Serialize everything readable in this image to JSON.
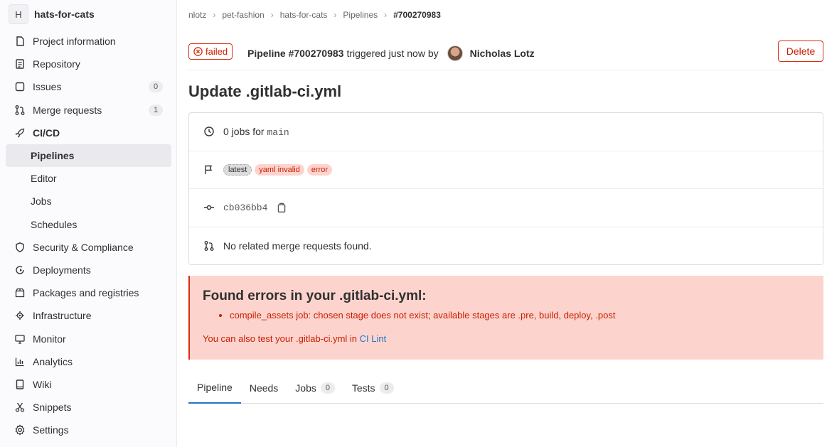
{
  "project": {
    "avatar_letter": "H",
    "name": "hats-for-cats"
  },
  "sidebar": {
    "items": [
      {
        "label": "Project information",
        "icon": "info-icon"
      },
      {
        "label": "Repository",
        "icon": "document-icon"
      },
      {
        "label": "Issues",
        "icon": "issues-icon",
        "count": "0"
      },
      {
        "label": "Merge requests",
        "icon": "merge-request-icon",
        "count": "1"
      },
      {
        "label": "CI/CD",
        "icon": "rocket-icon"
      },
      {
        "label": "Pipelines"
      },
      {
        "label": "Editor"
      },
      {
        "label": "Jobs"
      },
      {
        "label": "Schedules"
      },
      {
        "label": "Security & Compliance",
        "icon": "shield-icon"
      },
      {
        "label": "Deployments",
        "icon": "deployments-icon"
      },
      {
        "label": "Packages and registries",
        "icon": "package-icon"
      },
      {
        "label": "Infrastructure",
        "icon": "cloud-gear-icon"
      },
      {
        "label": "Monitor",
        "icon": "monitor-icon"
      },
      {
        "label": "Analytics",
        "icon": "chart-icon"
      },
      {
        "label": "Wiki",
        "icon": "book-icon"
      },
      {
        "label": "Snippets",
        "icon": "scissors-icon"
      },
      {
        "label": "Settings",
        "icon": "gear-icon"
      }
    ]
  },
  "breadcrumb": [
    "nlotz",
    "pet-fashion",
    "hats-for-cats",
    "Pipelines",
    "#700270983"
  ],
  "header": {
    "status": "failed",
    "pipeline_id": "Pipeline #700270983",
    "triggered_text": "triggered just now by",
    "user": "Nicholas Lotz",
    "delete_label": "Delete"
  },
  "title": "Update .gitlab-ci.yml",
  "info": {
    "jobs_prefix": "0 jobs for",
    "branch": "main",
    "badges": [
      "latest",
      "yaml invalid",
      "error"
    ],
    "commit": "cb036bb4",
    "mr_text": "No related merge requests found."
  },
  "alert": {
    "title": "Found errors in your .gitlab-ci.yml:",
    "errors": [
      "compile_assets job: chosen stage does not exist; available stages are .pre, build, deploy, .post"
    ],
    "lint_prefix": "You can also test your .gitlab-ci.yml in",
    "lint_link": "CI Lint"
  },
  "tabs": [
    {
      "label": "Pipeline"
    },
    {
      "label": "Needs"
    },
    {
      "label": "Jobs",
      "count": "0"
    },
    {
      "label": "Tests",
      "count": "0"
    }
  ],
  "colors": {
    "danger": "#dd2b0e",
    "danger_bg": "#fdd4cd",
    "link": "#1f75cb",
    "active_tab": "#1f75cb"
  }
}
